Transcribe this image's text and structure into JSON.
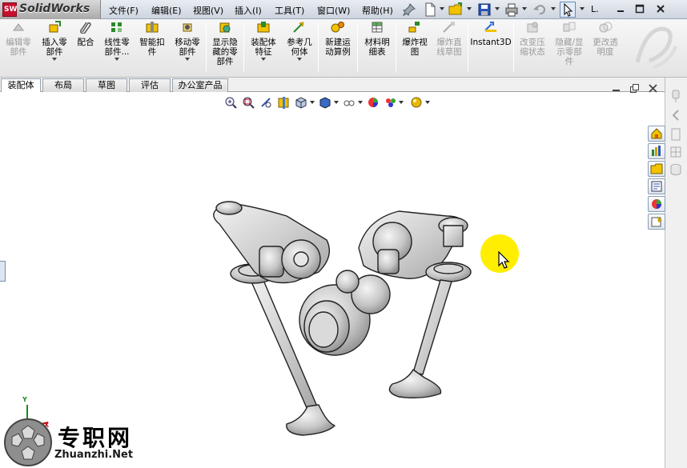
{
  "app": {
    "logo_badge": "SW",
    "title": "SolidWorks"
  },
  "menu": [
    "文件(F)",
    "编辑(E)",
    "视图(V)",
    "插入(I)",
    "工具(T)",
    "窗口(W)",
    "帮助(H)"
  ],
  "title_truncated": "L.",
  "command_manager": {
    "edit_component": "编辑零\n部件",
    "insert_components": "插入零\n部件",
    "mate": "配合",
    "linear_pattern": "线性零\n部件...",
    "smart_fasteners": "智能扣\n件",
    "move_component": "移动零\n部件",
    "show_hidden": "显示隐\n藏的零\n部件",
    "assembly_features": "装配体\n特征",
    "reference_geometry": "参考几\n何体",
    "new_motion_study": "新建运\n动算例",
    "bill_of_materials": "材料明\n细表",
    "exploded_view": "爆炸视\n图",
    "explode_line_sketch": "爆炸直\n线草图",
    "instant3d": "Instant3D",
    "suppression_states": "改变压\n缩状态",
    "hide_show_components": "隐藏/显\n示零部\n件",
    "change_transparency": "更改透\n明度"
  },
  "tabs": [
    "装配体",
    "布局",
    "草图",
    "评估",
    "办公室产品"
  ],
  "active_tab": "装配体",
  "triad": {
    "y": "Y",
    "x": "X"
  },
  "watermark": {
    "cn": "专职网",
    "en": "Zhuanzhi.Net"
  },
  "colors": {
    "accent_red": "#c8102e",
    "cursor_highlight": "#ffee00",
    "model_gray": "#c9c9c9"
  }
}
